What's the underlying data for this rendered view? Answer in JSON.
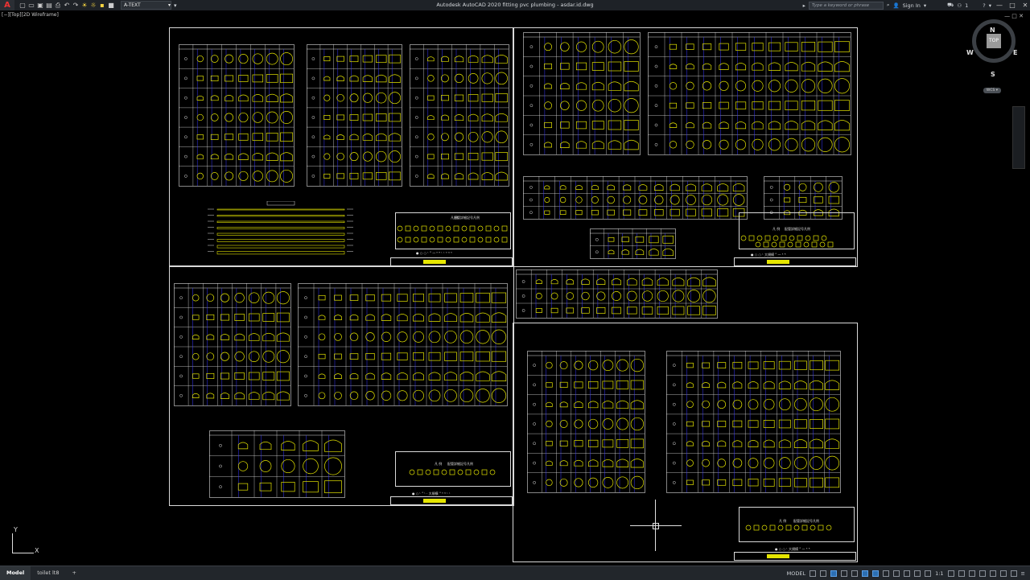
{
  "titlebar": {
    "app_letter": "A",
    "layer": "A-TEXT",
    "title": "Autodesk AutoCAD 2020   fitting pvc plumbing - asdar.id.dwg",
    "search_placeholder": "Type a keyword or phrase",
    "sign_in": "Sign In",
    "exchange_count": "1"
  },
  "viewport": {
    "label": "[−][Top][2D Wireframe]",
    "controls": "— □ ✕"
  },
  "compass": {
    "north": "N",
    "south": "S",
    "east": "E",
    "west": "W",
    "cube": "TOP",
    "wcs": "WCS ▾"
  },
  "ucs": {
    "x": "X",
    "y": "Y"
  },
  "statusbar": {
    "tabs": [
      "Model",
      "toilet lt8"
    ],
    "add_tab": "+",
    "model_label": "MODEL",
    "scale": "1:1"
  },
  "sheets": {
    "title_label_a": "ᴴᴷ ᴰᴼᴼ ᴷᴿ",
    "note_a": "ᴼᴼᴼᴼ ᴰᴼᴼ",
    "note_b": "ᴰᴼᴼ ᴼ ᴼ ᴰᴼᴼᴰ",
    "legend_heading": "凡 例",
    "legend_text": "配管詳細記号凡例",
    "sheet_note_1": "● ○ ○ ᴸ ° 一 ᴷ ᴿ ᴸ ᴸ ᴼ ᴰ ᴷ",
    "sheet_note_2": "● ○ ○ ᴸ 大規模 ° 一 ᴷ ᴿ",
    "sheet_note_3": "● ○ ᴸ ° ᴸ · 大規模 ° ᴷ ᴰ ᴸ ᴸ"
  }
}
